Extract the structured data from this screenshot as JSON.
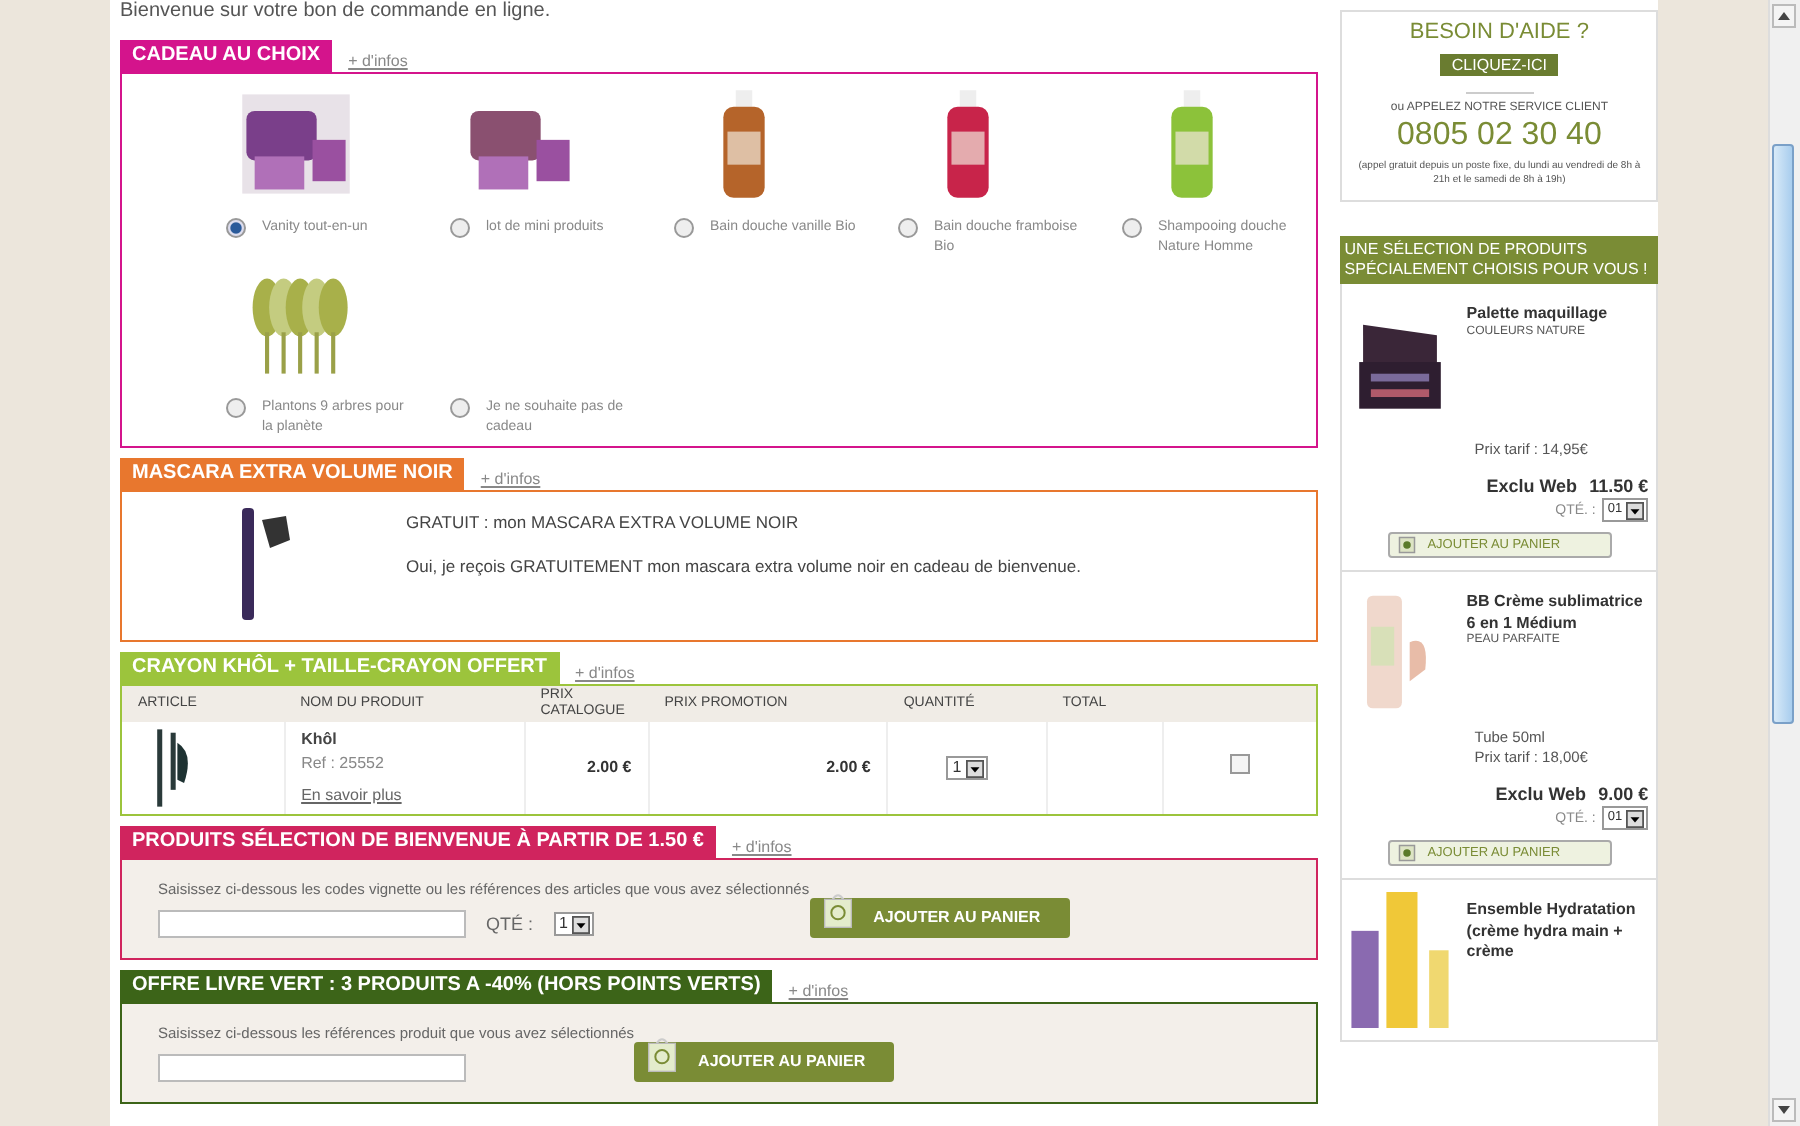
{
  "intro": "Bienvenue sur votre bon de commande en ligne.",
  "sections": [
    {
      "kind": "gifts",
      "title": "CADEAU AU CHOIX",
      "color": "#d4148c",
      "more": "+ d'infos",
      "options": [
        {
          "label": "Vanity tout-en-un",
          "selected": true
        },
        {
          "label": "lot de mini produits",
          "selected": false
        },
        {
          "label": "Bain douche vanille Bio",
          "selected": false
        },
        {
          "label": "Bain douche framboise Bio",
          "selected": false
        },
        {
          "label": "Shampooing douche Nature Homme",
          "selected": false
        },
        {
          "label": "Plantons 9 arbres pour la planète",
          "selected": false
        },
        {
          "label": "Je ne souhaite pas de cadeau",
          "selected": false
        }
      ]
    },
    {
      "kind": "offer",
      "title": "MASCARA EXTRA VOLUME NOIR",
      "color": "#e8772e",
      "more": "+ d'infos",
      "lines": [
        "GRATUIT : mon MASCARA EXTRA VOLUME NOIR",
        "Oui, je reçois GRATUITEMENT mon mascara extra volume noir en cadeau de bienvenue."
      ]
    },
    {
      "kind": "table",
      "title": "CRAYON KHÔL + TAILLE-CRAYON OFFERT",
      "color": "#9cc43c",
      "more": "+ d'infos",
      "columns": [
        "ARTICLE",
        "NOM DU PRODUIT",
        "PRIX CATALOGUE",
        "PRIX PROMOTION",
        "QUANTITÉ",
        "TOTAL"
      ],
      "rows": [
        {
          "name": "Khôl",
          "ref": "Ref : 25552",
          "link": "En savoir plus",
          "catalogue": "2.00 €",
          "promotion": "2.00 €",
          "quantity": "1",
          "checked": false
        }
      ]
    },
    {
      "kind": "entry",
      "title": "PRODUITS SÉLECTION DE BIENVENUE À PARTIR DE 1.50 €",
      "color": "#d0245e",
      "more": "+ d'infos",
      "instruction": "Saisissez ci-dessous les codes vignette ou les références des articles que vous avez sélectionnés",
      "qty_label": "QTÉ :",
      "quantity": "1",
      "button": "AJOUTER AU PANIER"
    },
    {
      "kind": "entry",
      "title": "OFFRE LIVRE VERT : 3 PRODUITS A -40% (HORS POINTS VERTS)",
      "color": "#3c6418",
      "more": "+ d'infos",
      "instruction": "Saisissez ci-dessous les références produit que vous avez sélectionnés",
      "button": "AJOUTER AU PANIER"
    }
  ],
  "help": {
    "title": "BESOIN D'AIDE ?",
    "button": "CLIQUEZ-ICI",
    "call": "ou APPELEZ NOTRE SERVICE CLIENT",
    "phone": "0805 02 30 40",
    "note": "(appel gratuit depuis un poste fixe, du lundi au vendredi de 8h à 21h et le samedi de 8h à 19h)"
  },
  "selection": {
    "title": "UNE SÉLECTION DE PRODUITS SPÉCIALEMENT CHOISIS POUR VOUS !",
    "products": [
      {
        "name": "Palette maquillage",
        "range": "COULEURS NATURE",
        "details": [
          "Prix tarif : 14,95€"
        ],
        "exclu": "Exclu Web",
        "price": "11.50 €",
        "qty_label": "QTÉ. :",
        "quantity": "01",
        "button": "AJOUTER AU PANIER"
      },
      {
        "name": "BB Crème sublimatrice 6 en 1 Médium",
        "range": "PEAU PARFAITE",
        "details": [
          "Tube 50ml",
          "Prix tarif : 18,00€"
        ],
        "exclu": "Exclu Web",
        "price": "9.00 €",
        "qty_label": "QTÉ. :",
        "quantity": "01",
        "button": "AJOUTER AU PANIER"
      },
      {
        "name": "Ensemble Hydratation (crème hydra main + crème"
      }
    ]
  }
}
